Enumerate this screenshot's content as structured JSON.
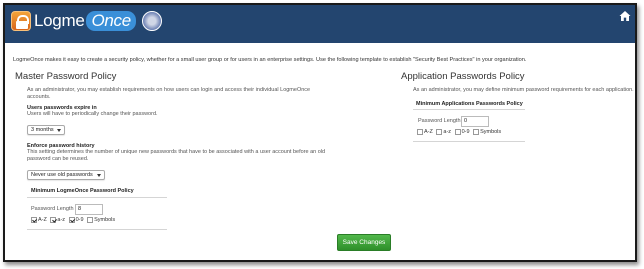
{
  "header": {
    "logo_main": "Logme",
    "logo_accent": "Once"
  },
  "intro": "LogmeOnce makes it easy to create a security policy, whether for a small user group or for users in an enterprise settings. Use the following template to establish \"Security Best Practices\" in your organization.",
  "master": {
    "title": "Master Password Policy",
    "description_1": "As an administrator, you may establish requirements on how users can login and access their individual LogmeOnce",
    "description_2": "accounts.",
    "expire_label": "Users passwords expire in",
    "expire_help": "Users will have to periodically change their password.",
    "expire_value": "3 months",
    "history_label": "Enforce password history",
    "history_help_1": "This setting determines the number of unique new passwords that have to be associated with a user account before an old",
    "history_help_2": "password can be reused.",
    "history_value": "Never use old passwords",
    "min_policy_title": "Minimum LogmeOnce Password Policy",
    "length_label": "Password Length",
    "length_value": "8",
    "opt_az_upper": "A-Z",
    "opt_az_lower": "a-z",
    "opt_digits": "0-9",
    "opt_symbols": "Symbols"
  },
  "application": {
    "title": "Application Passwords Policy",
    "description": "As an administrator, you may define minimum password requirements for each application.",
    "min_policy_title": "Minimum Applications Passwords Policy",
    "length_label": "Password Length",
    "length_value": "0",
    "opt_az_upper": "A-Z",
    "opt_az_lower": "a-z",
    "opt_digits": "0-9",
    "opt_symbols": "Symbols"
  },
  "actions": {
    "save_label": "Save Changes"
  },
  "colors": {
    "header_bg": "#23456f",
    "save_button": "#3fa33a"
  },
  "checkbox_state": {
    "master": {
      "upper": true,
      "lower": true,
      "digits": true,
      "symbols": false
    },
    "application": {
      "upper": false,
      "lower": false,
      "digits": false,
      "symbols": false
    }
  }
}
